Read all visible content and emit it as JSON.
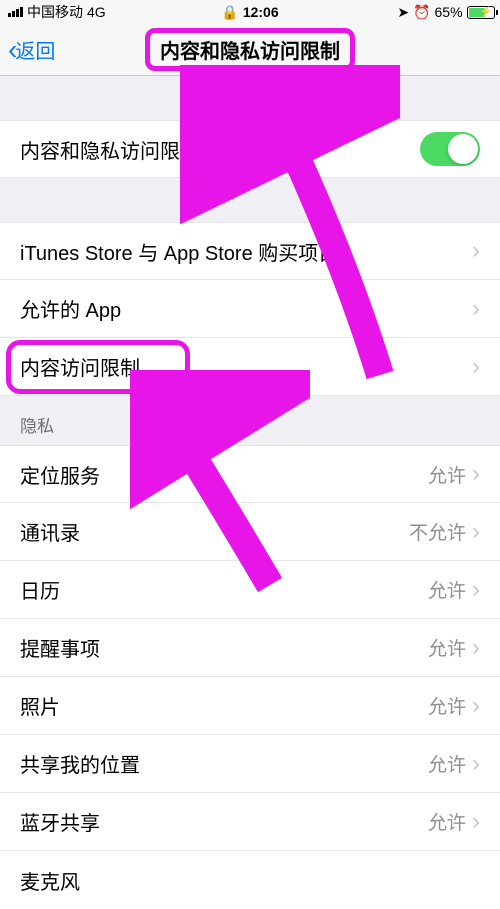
{
  "status": {
    "carrier": "中国移动",
    "network": "4G",
    "time": "12:06",
    "battery": "65%"
  },
  "nav": {
    "back": "返回",
    "title": "内容和隐私访问限制"
  },
  "toggle": {
    "label": "内容和隐私访问限制"
  },
  "group1": [
    {
      "label": "iTunes Store 与 App Store 购买项目"
    },
    {
      "label": "允许的 App"
    },
    {
      "label": "内容访问限制"
    }
  ],
  "privacy_header": "隐私",
  "privacy": [
    {
      "label": "定位服务",
      "value": "允许"
    },
    {
      "label": "通讯录",
      "value": "不允许"
    },
    {
      "label": "日历",
      "value": "允许"
    },
    {
      "label": "提醒事项",
      "value": "允许"
    },
    {
      "label": "照片",
      "value": "允许"
    },
    {
      "label": "共享我的位置",
      "value": "允许"
    },
    {
      "label": "蓝牙共享",
      "value": "允许"
    },
    {
      "label": "麦克风",
      "value": ""
    }
  ]
}
